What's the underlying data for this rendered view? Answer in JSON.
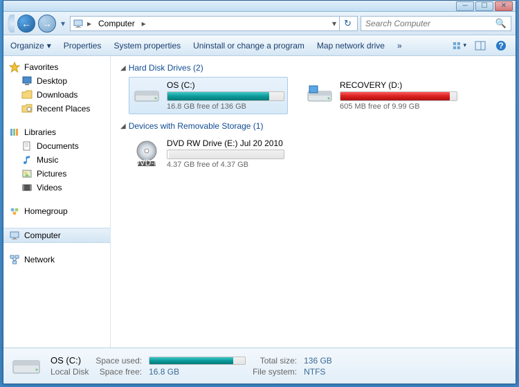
{
  "window_controls": {
    "minimize": "─",
    "maximize": "☐",
    "close": "✕"
  },
  "nav": {
    "back_glyph": "←",
    "forward_glyph": "→",
    "history_glyph": "▾",
    "breadcrumb": {
      "root": "Computer",
      "arrow": "▸"
    },
    "addr_dd": "▾",
    "refresh_glyph": "↻"
  },
  "search": {
    "placeholder": "Search Computer",
    "icon": "🔍"
  },
  "toolbar": {
    "organize": "Organize",
    "properties": "Properties",
    "system_properties": "System properties",
    "uninstall": "Uninstall or change a program",
    "map_drive": "Map network drive",
    "more": "»",
    "dd": "▾"
  },
  "sidebar": {
    "favorites": {
      "label": "Favorites",
      "items": [
        "Desktop",
        "Downloads",
        "Recent Places"
      ]
    },
    "libraries": {
      "label": "Libraries",
      "items": [
        "Documents",
        "Music",
        "Pictures",
        "Videos"
      ]
    },
    "homegroup": {
      "label": "Homegroup"
    },
    "computer": {
      "label": "Computer"
    },
    "network": {
      "label": "Network"
    }
  },
  "content": {
    "section1": {
      "title": "Hard Disk Drives (2)",
      "tri": "◢"
    },
    "drives": [
      {
        "name": "OS (C:)",
        "status": "16.8 GB free of 136 GB",
        "fill_class": "fill-teal",
        "selected": true
      },
      {
        "name": "RECOVERY (D:)",
        "status": "605 MB free of 9.99 GB",
        "fill_class": "fill-red",
        "selected": false
      }
    ],
    "section2": {
      "title": "Devices with Removable Storage (1)",
      "tri": "◢"
    },
    "removable": [
      {
        "name": "DVD RW Drive (E:) Jul 20 2010",
        "status": "4.37 GB free of 4.37 GB",
        "fill_class": "fill-white"
      }
    ]
  },
  "status": {
    "title": "OS (C:)",
    "subtitle": "Local Disk",
    "space_used_label": "Space used:",
    "space_free_label": "Space free:",
    "space_free_val": "16.8 GB",
    "total_size_label": "Total size:",
    "total_size_val": "136 GB",
    "fs_label": "File system:",
    "fs_val": "NTFS"
  }
}
